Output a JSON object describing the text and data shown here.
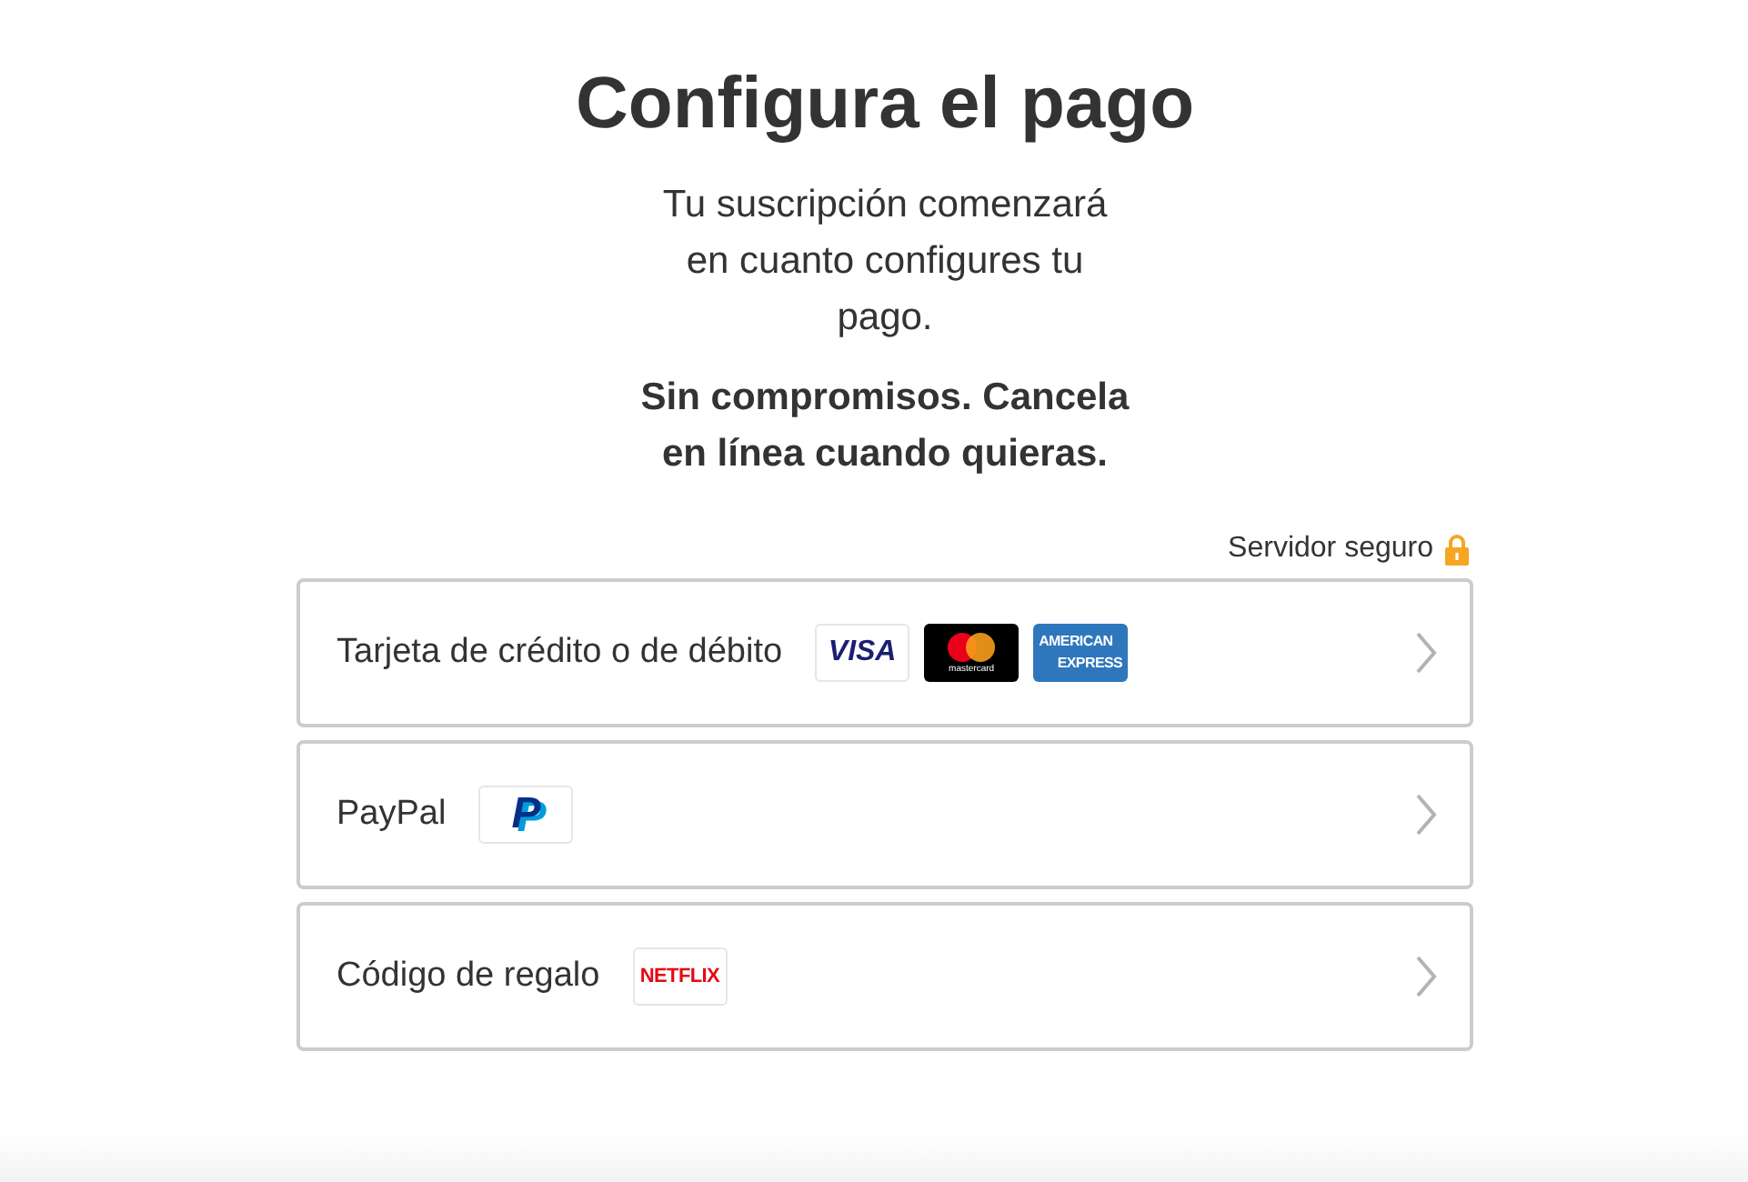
{
  "title": "Configura el pago",
  "intro": "Tu suscripción comenzará en cuanto configures tu pago.",
  "note": "Sin compromisos. Cancela en línea cuando quieras.",
  "secure_label": "Servidor seguro",
  "options": [
    {
      "label": "Tarjeta de crédito o de débito",
      "logos": [
        {
          "kind": "visa",
          "text": "VISA"
        },
        {
          "kind": "mastercard",
          "text": "mastercard"
        },
        {
          "kind": "amex",
          "lines": [
            "AMERICAN",
            "EXPRESS"
          ]
        }
      ]
    },
    {
      "label": "PayPal",
      "logos": [
        {
          "kind": "paypal",
          "text": "P"
        }
      ]
    },
    {
      "label": "Código de regalo",
      "logos": [
        {
          "kind": "netflix",
          "text": "NETFLIX"
        }
      ]
    }
  ]
}
